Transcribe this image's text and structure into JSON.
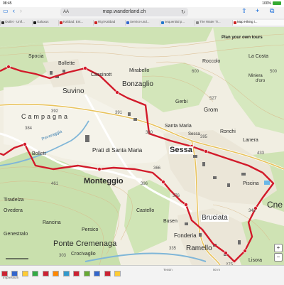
{
  "status": {
    "time": "08:45",
    "battery": "100%"
  },
  "browser": {
    "reader_label": "AA",
    "url": "map.wanderland.ch",
    "tabs": [
      {
        "label": "Outlet · Unif...",
        "color": "#333333"
      },
      {
        "label": "Galaxus",
        "color": "#1b1b1b"
      },
      {
        "label": "Kaltbad: Ent...",
        "color": "#cc2222"
      },
      {
        "label": "Rigi Kaltbad",
        "color": "#cc2222"
      },
      {
        "label": "Service und...",
        "color": "#3366cc"
      },
      {
        "label": "sequential p...",
        "color": "#2277cc"
      },
      {
        "label": "The Water Tr...",
        "color": "#888888"
      },
      {
        "label": "Map Hiking i...",
        "color": "#cc2222"
      }
    ],
    "active_tab": 7
  },
  "map": {
    "promo": "Plan your own tours",
    "route_color": "#d21a2a",
    "labels": [
      {
        "text": "Spocia",
        "size": 7
      },
      {
        "text": "Bollette",
        "size": 7
      },
      {
        "text": "Cassinott",
        "size": 7
      },
      {
        "text": "Mirabello",
        "size": 7
      },
      {
        "text": "Roccolo",
        "size": 7
      },
      {
        "text": "La Costa",
        "size": 7
      },
      {
        "text": "Suvino",
        "size": 10
      },
      {
        "text": "Bonzaglio",
        "size": 10
      },
      {
        "text": "Miniera",
        "size": 6
      },
      {
        "text": "d'oro",
        "size": 6
      },
      {
        "text": "Gerbi",
        "size": 7
      },
      {
        "text": "Grom",
        "size": 8
      },
      {
        "text": "Campagna",
        "size": 9
      },
      {
        "text": "Santa Maria",
        "size": 7
      },
      {
        "text": "Ronchi",
        "size": 7
      },
      {
        "text": "Lanera",
        "size": 7
      },
      {
        "text": "Bollett",
        "size": 7
      },
      {
        "text": "Prati di Santa Maria",
        "size": 8
      },
      {
        "text": "Sessa",
        "size": 11
      },
      {
        "text": "Monteggio",
        "size": 11
      },
      {
        "text": "Tiradelza",
        "size": 7
      },
      {
        "text": "Castello",
        "size": 7
      },
      {
        "text": "Piscina",
        "size": 7
      },
      {
        "text": "Bruciata",
        "size": 10
      },
      {
        "text": "Busen",
        "size": 7
      },
      {
        "text": "Cne",
        "size": 12
      },
      {
        "text": "Genestralo",
        "size": 7
      },
      {
        "text": "Rancina",
        "size": 7
      },
      {
        "text": "Persico",
        "size": 7
      },
      {
        "text": "Fonderia",
        "size": 8
      },
      {
        "text": "Ponte Cremenaga",
        "size": 11
      },
      {
        "text": "Crocivaglio",
        "size": 7
      },
      {
        "text": "Ramello",
        "size": 10
      },
      {
        "text": "Lisora",
        "size": 7
      },
      {
        "text": "Peveraggia",
        "size": 6
      },
      {
        "text": "Sessa",
        "size": 6
      },
      {
        "text": "Ovedera",
        "size": 7
      }
    ],
    "elevations": [
      "392",
      "384",
      "391",
      "380",
      "395",
      "433",
      "461",
      "366",
      "376",
      "343",
      "335",
      "303",
      "275",
      "527",
      "500",
      "600",
      "396"
    ]
  },
  "bottom": {
    "left_text": "Impressum",
    "mid_text": "Tessin",
    "scale_text": "50 m"
  }
}
